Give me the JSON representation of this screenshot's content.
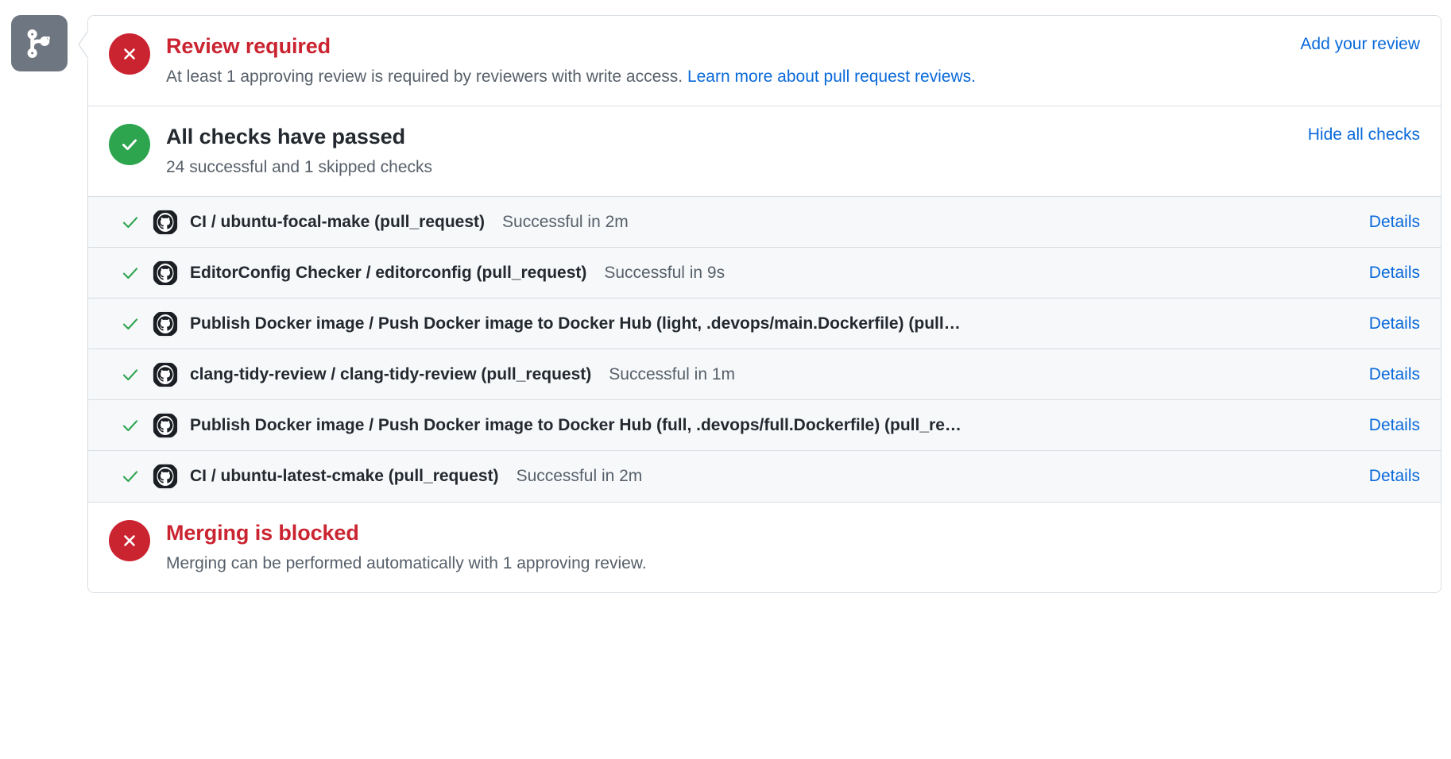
{
  "state_badge": {
    "icon": "git-merge-icon",
    "color": "#6e7781"
  },
  "review_section": {
    "icon": "x-circle-icon",
    "icon_color": "#cb2431",
    "title": "Review required",
    "title_color": "#cb2431",
    "description_before_link": "At least 1 approving review is required by reviewers with write access. ",
    "description_link": "Learn more about pull request reviews.",
    "action_label": "Add your review",
    "link_color": "#0969da"
  },
  "checks_section": {
    "icon": "check-circle-icon",
    "icon_color": "#2da44e",
    "title": "All checks have passed",
    "description": "24 successful and 1 skipped checks",
    "action_label": "Hide all checks"
  },
  "checks": [
    {
      "state_icon": "check-icon",
      "avatar": "github-actions-octocat-icon",
      "name": "CI / ubuntu-focal-make (pull_request)",
      "status": "Successful in 2m",
      "details_label": "Details"
    },
    {
      "state_icon": "check-icon",
      "avatar": "github-actions-octocat-icon",
      "name": "EditorConfig Checker / editorconfig (pull_request)",
      "status": "Successful in 9s",
      "details_label": "Details"
    },
    {
      "state_icon": "check-icon",
      "avatar": "github-actions-octocat-icon",
      "name": "Publish Docker image / Push Docker image to Docker Hub (light, .devops/main.Dockerfile) (pull…",
      "status": "",
      "details_label": "Details"
    },
    {
      "state_icon": "check-icon",
      "avatar": "github-actions-octocat-icon",
      "name": "clang-tidy-review / clang-tidy-review (pull_request)",
      "status": "Successful in 1m",
      "details_label": "Details"
    },
    {
      "state_icon": "check-icon",
      "avatar": "github-actions-octocat-icon",
      "name": "Publish Docker image / Push Docker image to Docker Hub (full, .devops/full.Dockerfile) (pull_re…",
      "status": "",
      "details_label": "Details"
    },
    {
      "state_icon": "check-icon",
      "avatar": "github-actions-octocat-icon",
      "name": "CI / ubuntu-latest-cmake (pull_request)",
      "status": "Successful in 2m",
      "details_label": "Details"
    }
  ],
  "blocked_section": {
    "icon": "x-circle-icon",
    "icon_color": "#cb2431",
    "title": "Merging is blocked",
    "title_color": "#cb2431",
    "description": "Merging can be performed automatically with 1 approving review."
  }
}
